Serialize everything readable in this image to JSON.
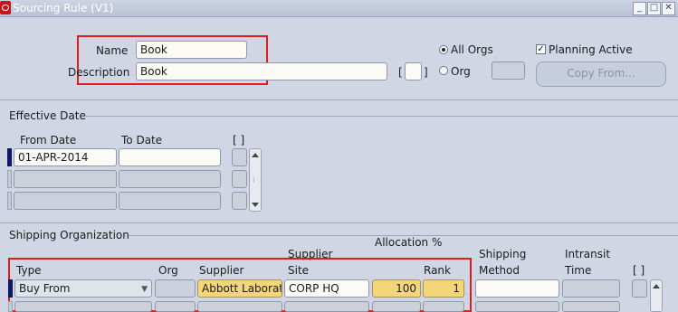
{
  "window": {
    "title": "Sourcing Rule (V1)"
  },
  "header": {
    "name_label": "Name",
    "name_value": "Book",
    "description_label": "Description",
    "description_value": "Book",
    "desc_flex_label": "[",
    "desc_flex_close": "]",
    "all_orgs_label": "All Orgs",
    "org_label": "Org",
    "planning_active_label": "Planning Active",
    "copy_from_label": "Copy From..."
  },
  "effective": {
    "section_title": "Effective Date",
    "from_label": "From Date",
    "to_label": "To Date",
    "flex_label": "[ ]",
    "rows": [
      {
        "from": "01-APR-2014",
        "to": ""
      },
      {
        "from": "",
        "to": ""
      },
      {
        "from": "",
        "to": ""
      }
    ]
  },
  "shipping": {
    "section_title": "Shipping Organization",
    "allocation_label": "Allocation %",
    "columns": {
      "type": "Type",
      "org": "Org",
      "supplier": "Supplier",
      "supplier_site_top": "Supplier",
      "supplier_site_bottom": "Site",
      "rank": "Rank",
      "shipping_top": "Shipping",
      "shipping_bottom": "Method",
      "intransit_top": "Intransit",
      "intransit_bottom": "Time",
      "flex": "[ ]"
    },
    "rows": [
      {
        "type": "Buy From",
        "org": "",
        "supplier": "Abbott Laborato",
        "site": "CORP HQ",
        "allocation": "100",
        "rank": "1",
        "method": "",
        "time": ""
      }
    ]
  },
  "colors": {
    "highlight_box": "#e01c1c",
    "required_field": "#f3d57a",
    "background": "#d0d6e4"
  }
}
